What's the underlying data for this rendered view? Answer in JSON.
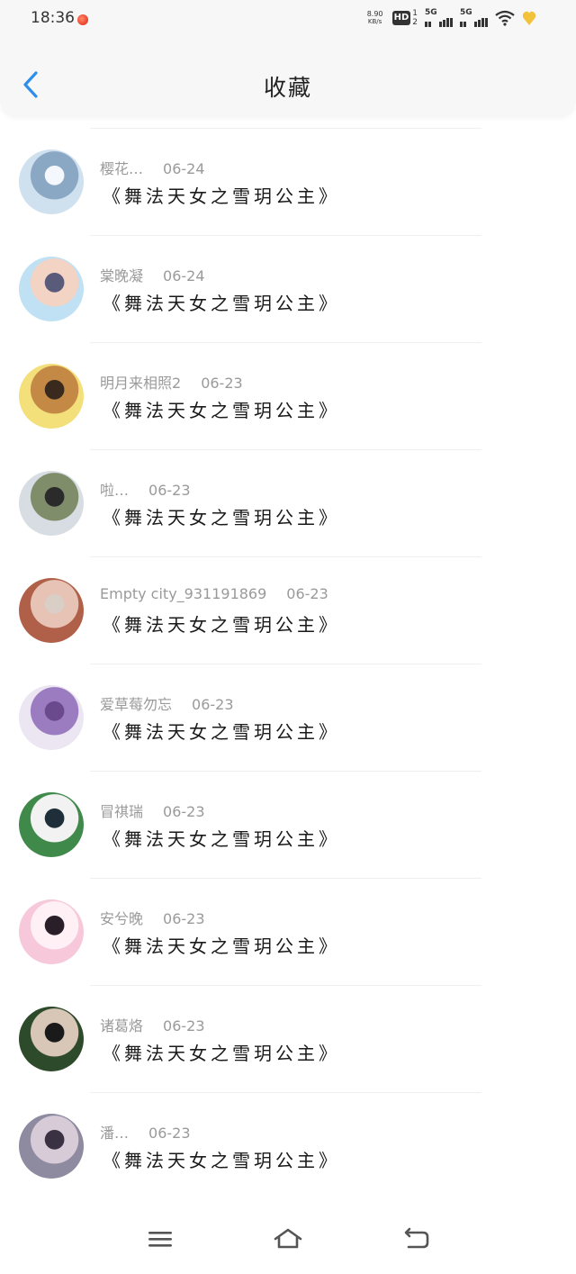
{
  "status": {
    "time": "18:36",
    "net_speed": "8.90",
    "net_unit": "KB/s",
    "hd": "HD",
    "hd_sub": "1\n2",
    "sig1": "5G",
    "sig2": "5G"
  },
  "header": {
    "title": "收藏"
  },
  "items": [
    {
      "user": "樱花…",
      "date": "06-24",
      "work": "《舞法天女之雪玥公主》",
      "avatar": {
        "bg1": "#cfe0ee",
        "bg2": "#8aa7c4",
        "accent": "#f4f7fb"
      }
    },
    {
      "user": "棠晚凝",
      "date": "06-24",
      "work": "《舞法天女之雪玥公主》",
      "avatar": {
        "bg1": "#bfe1f3",
        "bg2": "#f2d3c4",
        "accent": "#5a5a7a"
      }
    },
    {
      "user": "明月来相照2",
      "date": "06-23",
      "work": "《舞法天女之雪玥公主》",
      "avatar": {
        "bg1": "#f3e07a",
        "bg2": "#c48a45",
        "accent": "#3a2a1e"
      }
    },
    {
      "user": "啦…",
      "date": "06-23",
      "work": "《舞法天女之雪玥公主》",
      "avatar": {
        "bg1": "#d7dde2",
        "bg2": "#7f8d6a",
        "accent": "#2b2b2b"
      }
    },
    {
      "user": "Empty city_931191869",
      "date": "06-23",
      "work": "《舞法天女之雪玥公主》",
      "avatar": {
        "bg1": "#b06048",
        "bg2": "#e6c3b4",
        "accent": "#d9cfc7"
      }
    },
    {
      "user": "爱草莓勿忘",
      "date": "06-23",
      "work": "《舞法天女之雪玥公主》",
      "avatar": {
        "bg1": "#ece6f2",
        "bg2": "#9c7cc0",
        "accent": "#6a4a8c"
      }
    },
    {
      "user": "冒祺瑞",
      "date": "06-23",
      "work": "《舞法天女之雪玥公主》",
      "avatar": {
        "bg1": "#3f8a4a",
        "bg2": "#f2f2f2",
        "accent": "#1e2f3a"
      }
    },
    {
      "user": "安兮晚",
      "date": "06-23",
      "work": "《舞法天女之雪玥公主》",
      "avatar": {
        "bg1": "#f6c8da",
        "bg2": "#fff0f5",
        "accent": "#2a1e28"
      }
    },
    {
      "user": "诸葛烙",
      "date": "06-23",
      "work": "《舞法天女之雪玥公主》",
      "avatar": {
        "bg1": "#2d4a2a",
        "bg2": "#d8c6b6",
        "accent": "#1b1a1a"
      }
    },
    {
      "user": "潘…",
      "date": "06-23",
      "work": "《舞法天女之雪玥公主》",
      "avatar": {
        "bg1": "#8e8aa0",
        "bg2": "#d6cbd6",
        "accent": "#3a3242"
      }
    }
  ],
  "colors": {
    "accent": "#2f8fe8",
    "text": "#222222",
    "meta": "#9a9a9a"
  }
}
